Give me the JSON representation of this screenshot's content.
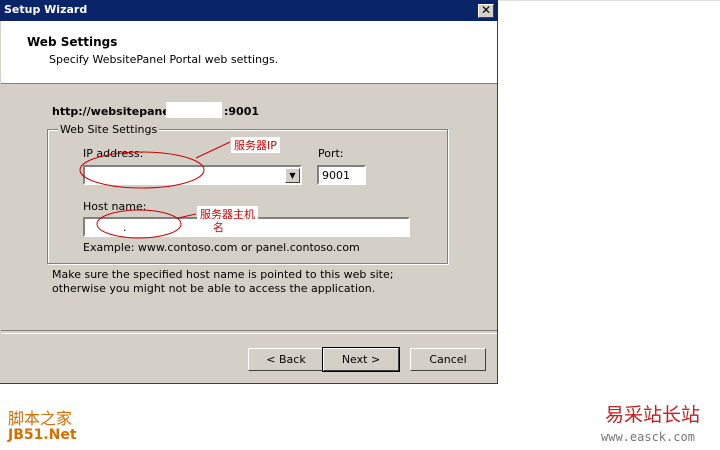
{
  "window": {
    "title": "Setup Wizard",
    "close_glyph": "✕"
  },
  "header": {
    "title": "Web Settings",
    "subtitle": "Specify WebsitePanel Portal web settings."
  },
  "url": {
    "prefix": "http://websitepanel.",
    "suffix": ":9001"
  },
  "group": {
    "legend": "Web Site Settings",
    "ip_label": "IP address:",
    "ip_value": "",
    "port_label": "Port:",
    "port_value": "9001",
    "host_label": "Host name:",
    "host_value": ".",
    "example": "Example: www.contoso.com or panel.contoso.com"
  },
  "annotations": {
    "ip": "服务器IP",
    "host_line1": "服务器主机",
    "host_line2": "名"
  },
  "note": "Make sure the specified host name is pointed to this web site; otherwise you might not be able to access the application.",
  "buttons": {
    "back": "< Back",
    "next": "Next >",
    "cancel": "Cancel"
  },
  "watermarks": {
    "left_1": "脚本之家",
    "left_2": "JB51.Net",
    "right_1": "易采站长站",
    "right_2": "www.easck.com"
  },
  "colors": {
    "titlebar": "#0a246a",
    "dialog_bg": "#d4d0c8",
    "annotation": "#cc0000"
  },
  "icons": {
    "dropdown": "chevron-down-icon",
    "close": "close-icon"
  }
}
